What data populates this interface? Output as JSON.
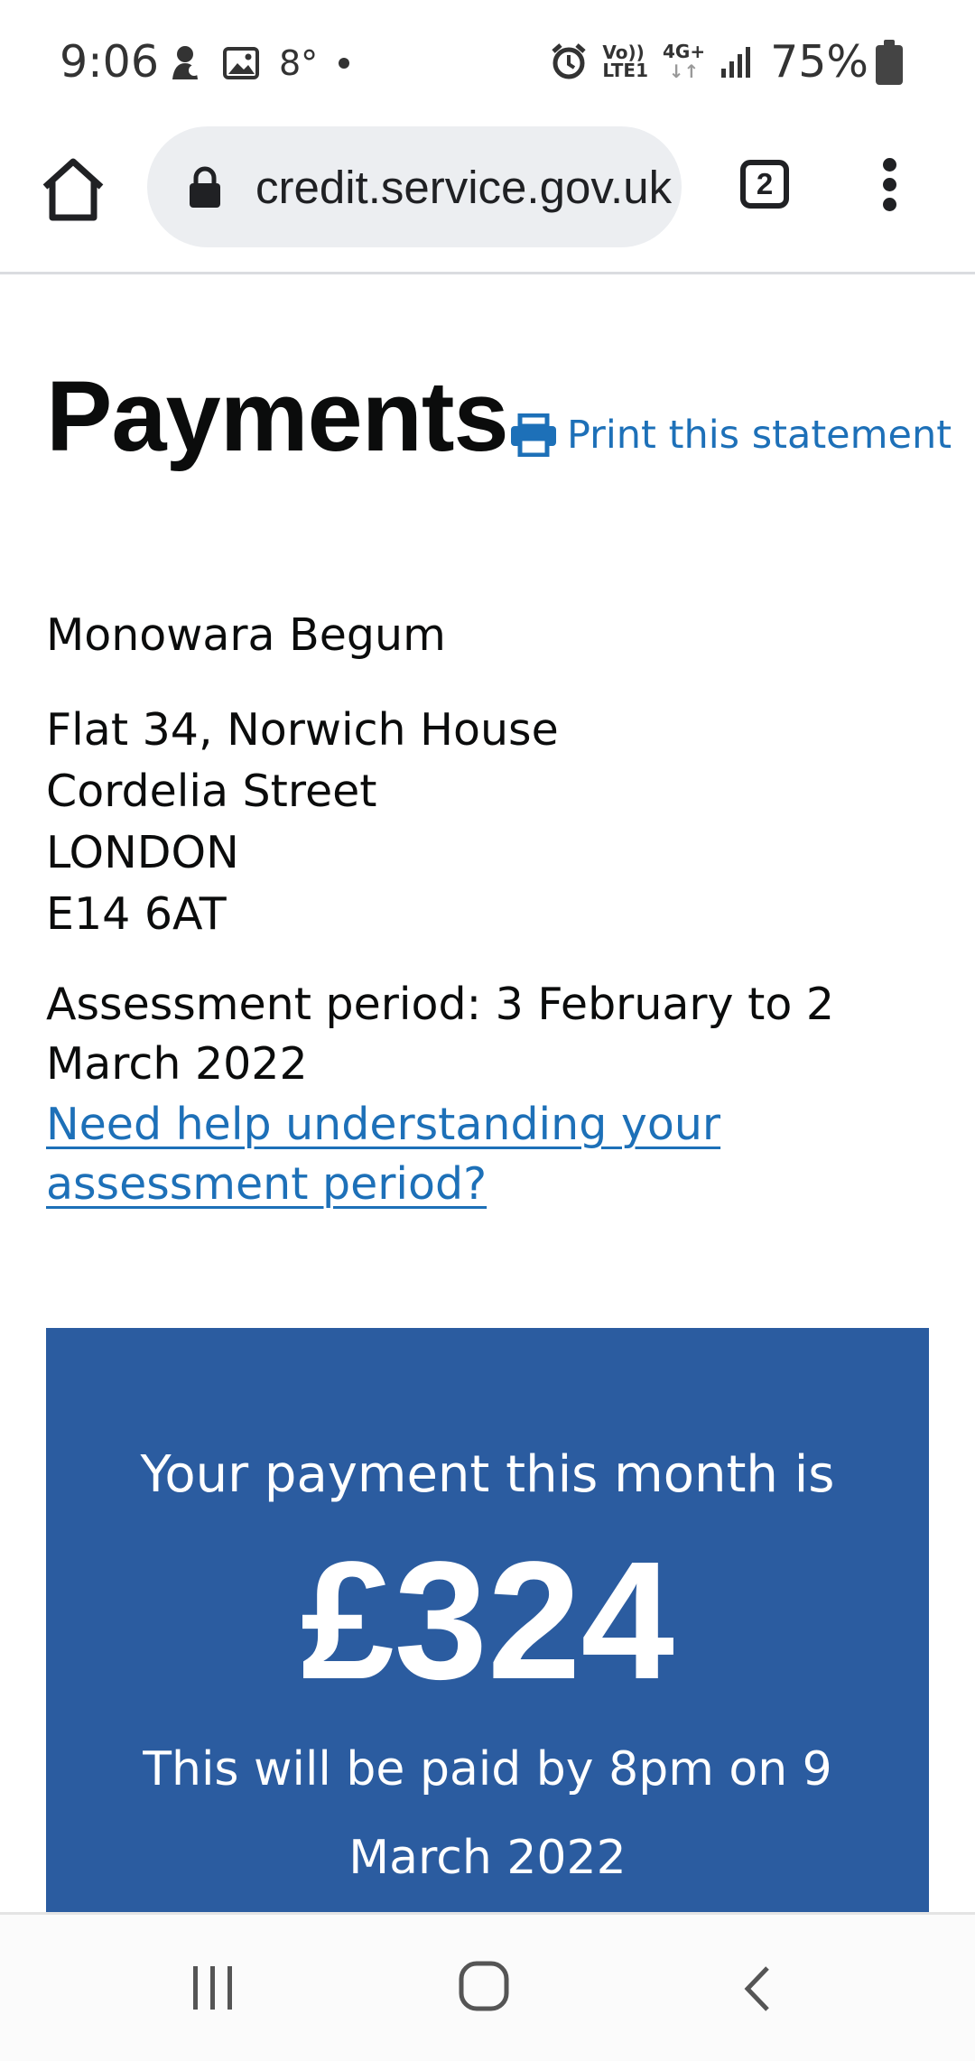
{
  "status_bar": {
    "time": "9:06",
    "temperature": "8°",
    "network_labels": [
      "Vo))",
      "LTE1",
      "4G+"
    ],
    "battery_percent": "75%"
  },
  "browser": {
    "url": "credit.service.gov.uk",
    "tab_count": "2",
    "icons": [
      "home-icon",
      "lock-icon",
      "tabs-icon",
      "menu-icon"
    ]
  },
  "page": {
    "title": "Payments",
    "print_link": "Print this statement",
    "name": "Monowara Begum",
    "address_lines": [
      "Flat 34, Norwich House",
      "Cordelia Street",
      "LONDON",
      "E14 6AT"
    ],
    "assessment_period": "Assessment period: 3 February to 2 March 2022",
    "help_link": "Need help understanding your assessment period?",
    "payment": {
      "intro": "Your payment this month is",
      "amount": "£324",
      "paid_by": "This will be paid by 8pm on 9 March 2022"
    }
  },
  "colors": {
    "link": "#1d70b8",
    "panel": "#2b5ca0",
    "text": "#0b0c0c"
  }
}
